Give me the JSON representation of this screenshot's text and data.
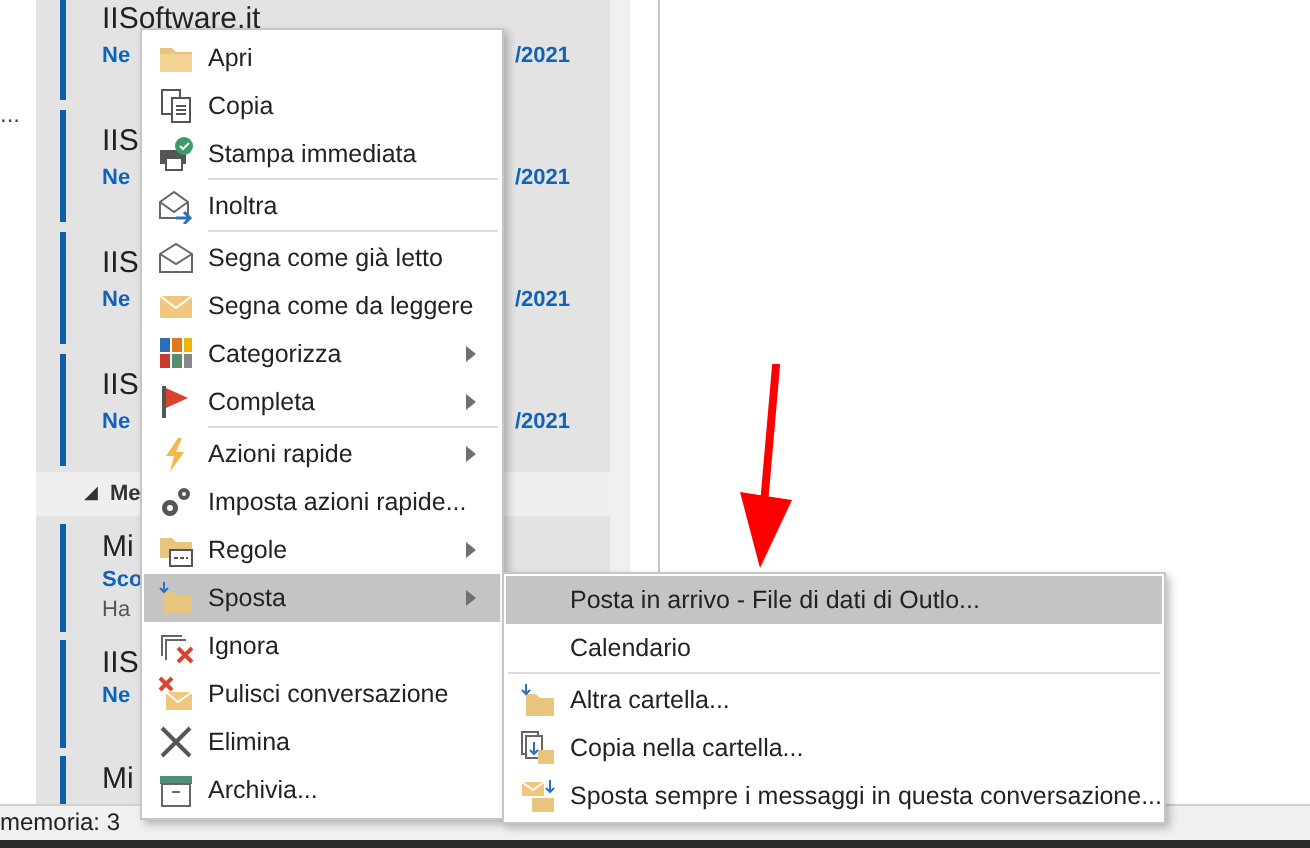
{
  "left_pane": {
    "ellipsis": "..."
  },
  "message_list": {
    "items": [
      {
        "title": "IISoftware.it",
        "subtitle": "Ne",
        "date": "/2021"
      },
      {
        "title": "IIS",
        "subtitle": "Ne",
        "date": "/2021"
      },
      {
        "title": "IIS",
        "subtitle": "Ne",
        "date": "/2021"
      },
      {
        "title": "IIS",
        "subtitle": "Ne",
        "date": "/2021"
      }
    ],
    "group": {
      "arrow": "◢",
      "label": "Me"
    },
    "group_items": [
      {
        "title": "Mi",
        "subtitle": "Sco",
        "preview": "Ha"
      },
      {
        "title": "IIS",
        "subtitle": "Ne"
      },
      {
        "title": "Mi"
      }
    ]
  },
  "context_menu": {
    "items": [
      {
        "label": "Apri",
        "has_submenu": false,
        "selected": false,
        "separator_before": false
      },
      {
        "label": "Copia",
        "has_submenu": false,
        "selected": false,
        "separator_before": false
      },
      {
        "label": "Stampa immediata",
        "has_submenu": false,
        "selected": false,
        "separator_before": false
      },
      {
        "label": "Inoltra",
        "has_submenu": false,
        "selected": false,
        "separator_before": true
      },
      {
        "label": "Segna come già letto",
        "has_submenu": false,
        "selected": false,
        "separator_before": true
      },
      {
        "label": "Segna come da leggere",
        "has_submenu": false,
        "selected": false,
        "separator_before": false
      },
      {
        "label": "Categorizza",
        "has_submenu": true,
        "selected": false,
        "separator_before": false
      },
      {
        "label": "Completa",
        "has_submenu": true,
        "selected": false,
        "separator_before": false
      },
      {
        "label": "Azioni rapide",
        "has_submenu": true,
        "selected": false,
        "separator_before": true
      },
      {
        "label": "Imposta azioni rapide...",
        "has_submenu": false,
        "selected": false,
        "separator_before": false
      },
      {
        "label": "Regole",
        "has_submenu": true,
        "selected": false,
        "separator_before": false
      },
      {
        "label": "Sposta",
        "has_submenu": true,
        "selected": true,
        "separator_before": false
      },
      {
        "label": "Ignora",
        "has_submenu": false,
        "selected": false,
        "separator_before": false
      },
      {
        "label": "Pulisci conversazione",
        "has_submenu": false,
        "selected": false,
        "separator_before": false
      },
      {
        "label": "Elimina",
        "has_submenu": false,
        "selected": false,
        "separator_before": false
      },
      {
        "label": "Archivia...",
        "has_submenu": false,
        "selected": false,
        "separator_before": false
      }
    ]
  },
  "submenu": {
    "items": [
      {
        "label": "Posta in arrivo - File di dati di Outlo...",
        "selected": true,
        "separator_before": false,
        "icon": false
      },
      {
        "label": "Calendario",
        "selected": false,
        "separator_before": false,
        "icon": false
      },
      {
        "label": "Altra cartella...",
        "selected": false,
        "separator_before": true,
        "icon": true
      },
      {
        "label": "Copia nella cartella...",
        "selected": false,
        "separator_before": false,
        "icon": true
      },
      {
        "label": "Sposta sempre i messaggi in questa conversazione...",
        "selected": false,
        "separator_before": false,
        "icon": true
      }
    ]
  },
  "status_bar": {
    "text": "memoria: 3"
  }
}
